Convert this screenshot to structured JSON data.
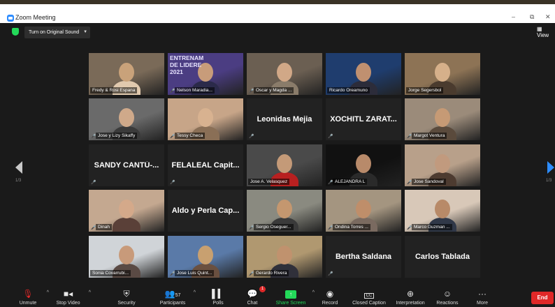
{
  "window": {
    "title": "Zoom Meeting",
    "minimize": "–",
    "restore": "⧉",
    "close": "✕"
  },
  "meeting_bar": {
    "original_sound_label": "Turn on Original Sound",
    "view_label": "View"
  },
  "pagination": {
    "left": "1/3",
    "right": "1/3"
  },
  "participants": [
    {
      "name": "Fredy & Rosi Espana",
      "muted": false,
      "video": true
    },
    {
      "name": "Nelson Maradia...",
      "muted": true,
      "video": true,
      "overlay_text": "ENTRENAM\nDE LIDERE\n2021"
    },
    {
      "name": "Oscar y Magda ...",
      "muted": true,
      "video": true
    },
    {
      "name": "Ricardo Oreamuno",
      "muted": false,
      "video": true
    },
    {
      "name": "Jorge Segersbol",
      "muted": false,
      "video": true,
      "active": true
    },
    {
      "name": "Jose y Lizy Sikaffy",
      "muted": true,
      "video": true
    },
    {
      "name": "Tessy Checa",
      "muted": true,
      "video": true
    },
    {
      "name": "Leonidas Mejia",
      "muted": true,
      "video": false
    },
    {
      "name": "XOCHITL ZARAT...",
      "muted": true,
      "video": false
    },
    {
      "name": "Margot Ventura",
      "muted": true,
      "video": true
    },
    {
      "name": "SANDY CANTÚ-...",
      "muted": true,
      "video": false
    },
    {
      "name": "FELALEAL Capit...",
      "muted": true,
      "video": false
    },
    {
      "name": "Jose A. Velasquez",
      "muted": false,
      "video": true
    },
    {
      "name": "ALEJANDRA L",
      "muted": true,
      "video": true
    },
    {
      "name": "Jose Sandoval",
      "muted": true,
      "video": true
    },
    {
      "name": "Dinah",
      "muted": true,
      "video": true
    },
    {
      "name": "Aldo y Perla Cap...",
      "muted": false,
      "video": false
    },
    {
      "name": "Sergio Oseguer...",
      "muted": true,
      "video": true
    },
    {
      "name": "Ondina Torres ...",
      "muted": true,
      "video": true
    },
    {
      "name": "Marco Guzman ...",
      "muted": true,
      "video": true
    },
    {
      "name": "Sonia Covarrubi...",
      "muted": false,
      "video": true
    },
    {
      "name": "Jose Luis Quint...",
      "muted": true,
      "video": true
    },
    {
      "name": "Gerardo Rivera",
      "muted": true,
      "video": true
    },
    {
      "name": "Bertha Saldana",
      "muted": true,
      "video": false
    },
    {
      "name": "Carlos Tablada",
      "muted": false,
      "video": false
    }
  ],
  "toolbar": {
    "unmute": "Unmute",
    "stop_video": "Stop Video",
    "security": "Security",
    "participants": "Participants",
    "participants_count": "57",
    "polls": "Polls",
    "chat": "Chat",
    "chat_badge": "1",
    "share_screen": "Share Screen",
    "record": "Record",
    "closed_caption": "Closed Caption",
    "closed_caption_icon_text": "CC",
    "interpretation": "Interpretation",
    "reactions": "Reactions",
    "more": "More",
    "end": "End"
  },
  "colors": {
    "background": "#1a1a1a",
    "active_speaker": "#c3e23a",
    "share_green": "#23d959",
    "end_red": "#e02828",
    "zoom_blue": "#2d8cff"
  }
}
